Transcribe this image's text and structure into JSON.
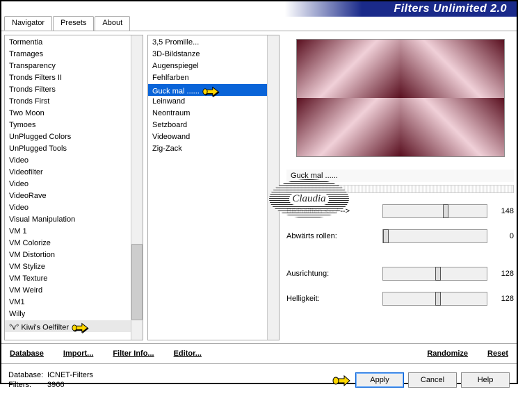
{
  "header": {
    "title": "Filters Unlimited 2.0"
  },
  "tabs": [
    "Navigator",
    "Presets",
    "About"
  ],
  "activeTab": 0,
  "leftList": [
    "Tormentia",
    "Tramages",
    "Transparency",
    "Tronds Filters II",
    "Tronds Filters",
    "Tronds First",
    "Two Moon",
    "Tymoes",
    "UnPlugged Colors",
    "UnPlugged Tools",
    "Video",
    "Videofilter",
    "Video",
    "VideoRave",
    "Video",
    "Visual Manipulation",
    "VM 1",
    "VM Colorize",
    "VM Distortion",
    "VM Stylize",
    "VM Texture",
    "VM Weird",
    "VM1",
    "Willy",
    "°v° Kiwi's Oelfilter"
  ],
  "leftSelectedIndex": 24,
  "midList": [
    "3,5 Promille...",
    "3D-Bildstanze",
    "Augenspiegel",
    "Fehlfarben",
    "Guck mal ......",
    "Leinwand",
    "Neontraum",
    "Setzboard",
    "Videowand",
    "Zig-Zack"
  ],
  "midSelectedIndex": 4,
  "currentFilter": "Guck mal ......",
  "params": [
    {
      "label": "Bildhälften <-- / -->",
      "value": 148,
      "max": 255
    },
    {
      "label": "Abwärts rollen:",
      "value": 0,
      "max": 255
    },
    {
      "label": "Ausrichtung:",
      "value": 128,
      "max": 255
    },
    {
      "label": "Helligkeit:",
      "value": 128,
      "max": 255
    }
  ],
  "toolbar": {
    "database": "Database",
    "import": "Import...",
    "filterInfo": "Filter Info...",
    "editor": "Editor...",
    "randomize": "Randomize",
    "reset": "Reset"
  },
  "footer": {
    "dbLabel": "Database:",
    "dbValue": "ICNET-Filters",
    "filtersLabel": "Filters:",
    "filtersValue": "3966"
  },
  "buttons": {
    "apply": "Apply",
    "cancel": "Cancel",
    "help": "Help"
  },
  "watermark": "Claudia"
}
